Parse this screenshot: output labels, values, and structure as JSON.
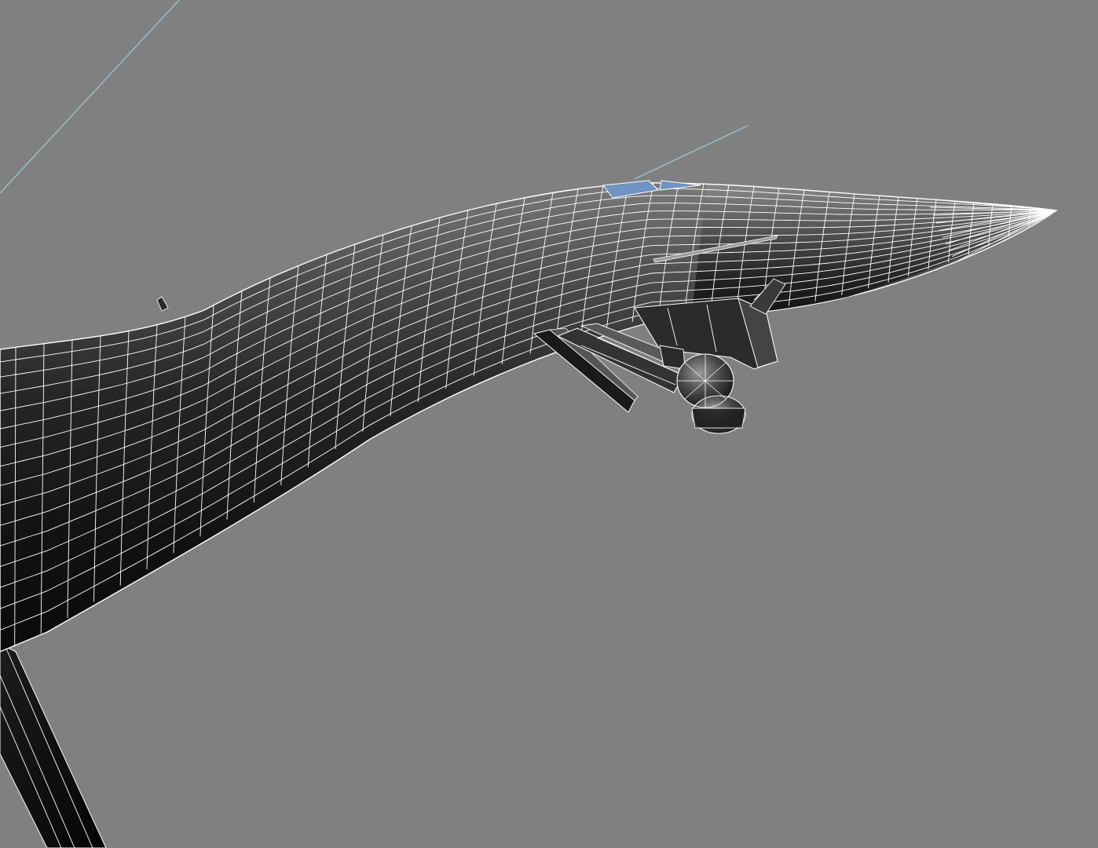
{
  "viewport": {
    "background": "#808080",
    "model": "aircraft-fuselage-wireframe",
    "shading": "smooth-shaded-with-wireframe-overlay",
    "mesh_color": "#ffffff",
    "surface_color": "#1a1a1a",
    "canopy_color": "#6f93c2",
    "guide_line_color": "#9cc4d6"
  }
}
